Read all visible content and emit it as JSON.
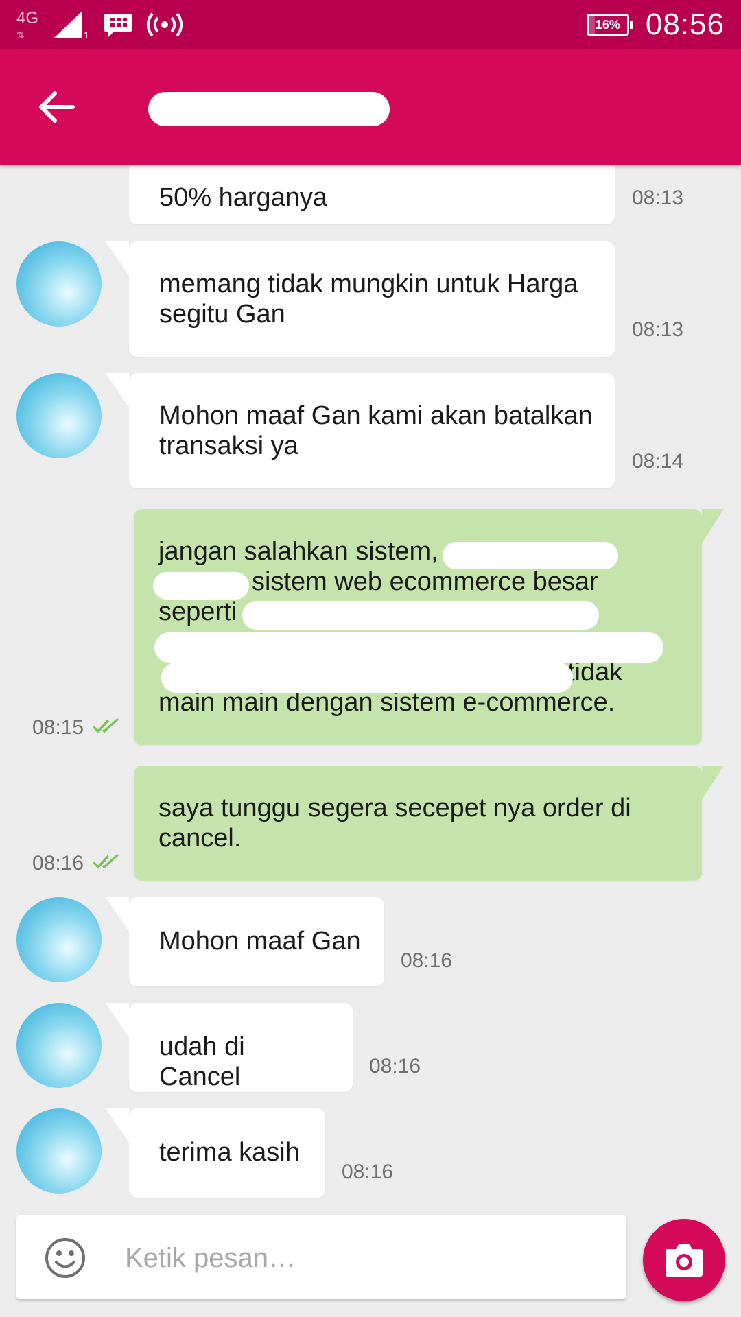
{
  "status_bar": {
    "network": "4G",
    "sim_index": "1",
    "battery_label": "16%",
    "battery_level": 0.16,
    "time": "08:56"
  },
  "header": {
    "accent_color": "#d4095a",
    "status_color": "#b8004e"
  },
  "messages": [
    {
      "direction": "in",
      "text": "50% harganya",
      "time": "08:13"
    },
    {
      "direction": "in",
      "text": "memang tidak mungkin untuk Harga segitu Gan",
      "time": "08:13"
    },
    {
      "direction": "in",
      "text": "Mohon maaf Gan kami akan batalkan transaksi ya",
      "time": "08:14"
    },
    {
      "direction": "out",
      "line1": "jangan salahkan sistem,",
      "line2": "sistem web ecommerce besar",
      "line3": "seperti",
      "line5": "tidak",
      "line6": "main main dengan sistem e-commerce.",
      "time": "08:15",
      "read": true
    },
    {
      "direction": "out",
      "text": "saya tunggu segera secepet nya order di cancel.",
      "time": "08:16",
      "read": true
    },
    {
      "direction": "in",
      "text": "Mohon maaf Gan",
      "time": "08:16"
    },
    {
      "direction": "in",
      "text": "udah di Cancel",
      "time": "08:16"
    },
    {
      "direction": "in",
      "text": "terima kasih",
      "time": "08:16"
    }
  ],
  "composer": {
    "placeholder": "Ketik pesan…"
  },
  "icons": {
    "back": "arrow-back-icon",
    "emoji": "emoji-icon",
    "camera": "camera-icon",
    "read_receipt": "double-check-icon"
  },
  "colors": {
    "incoming_bubble": "#ffffff",
    "outgoing_bubble": "#c5e4ac",
    "read_check": "#7cc25a"
  }
}
